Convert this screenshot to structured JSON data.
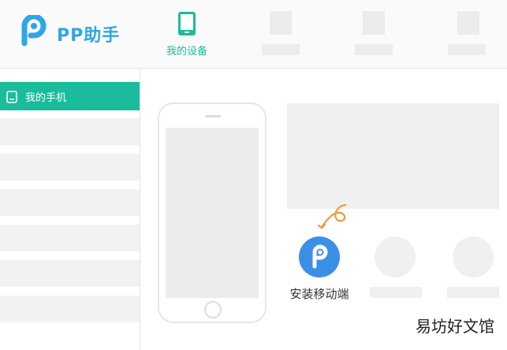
{
  "header": {
    "app_name": "PP助手",
    "logo_icon": "pp-logo-icon",
    "tabs": [
      {
        "label": "我的设备",
        "icon": "phone-device-icon",
        "active": true
      }
    ]
  },
  "sidebar": {
    "active_item": {
      "label": "我的手机",
      "icon": "phone-outline-icon"
    }
  },
  "main": {
    "install_label": "安装移动端",
    "install_icon": "pp-logo-icon"
  },
  "watermark": "易坊好文馆",
  "colors": {
    "accent": "#1bbc9b",
    "brand_blue": "#2fa6e6",
    "arrow_orange": "#f0984a"
  }
}
